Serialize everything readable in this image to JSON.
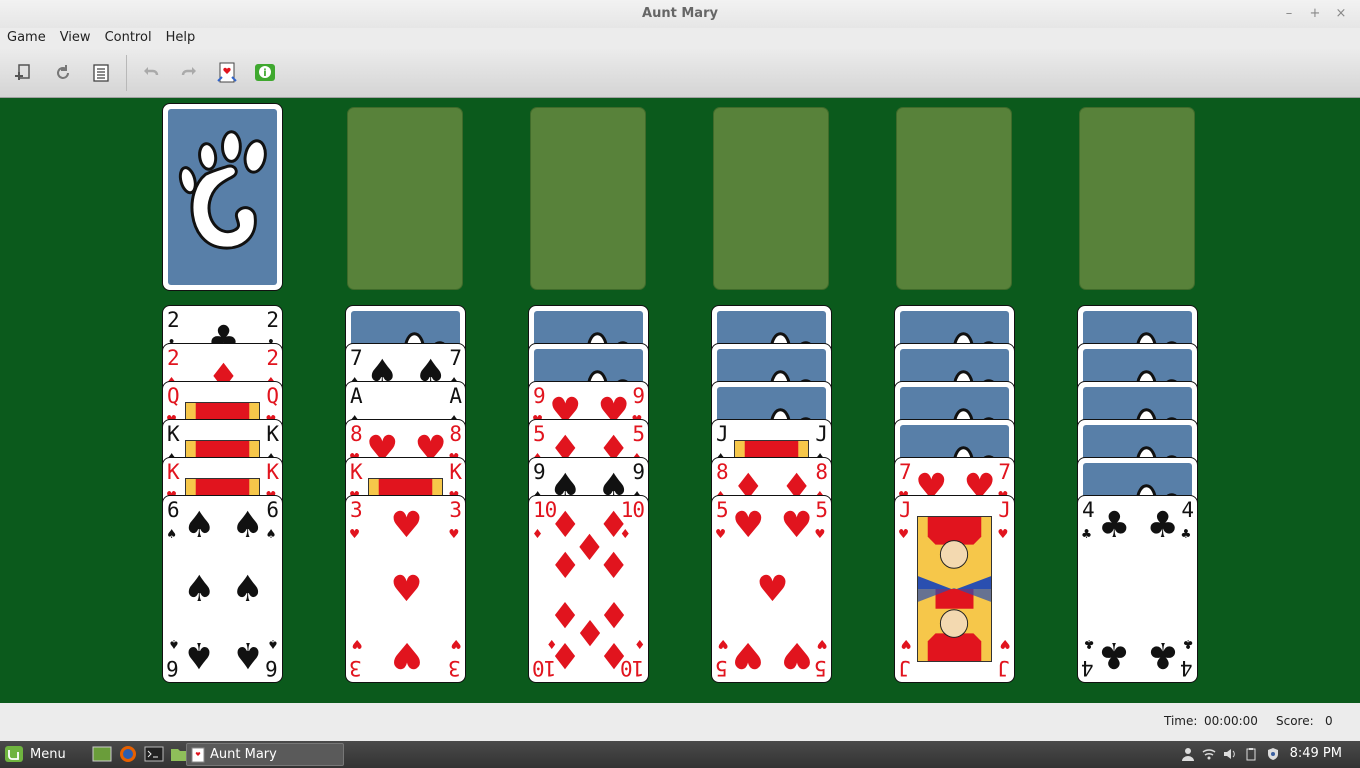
{
  "window": {
    "title": "Aunt Mary",
    "controls": [
      "–",
      "+",
      "×"
    ]
  },
  "menu": [
    "Game",
    "View",
    "Control",
    "Help"
  ],
  "toolbar": [
    "new-game-icon",
    "restart-icon",
    "statistics-icon",
    "undo-icon",
    "redo-icon",
    "hint-icon",
    "info-icon"
  ],
  "stock": {
    "face_down": true
  },
  "foundations": 5,
  "tableau": [
    {
      "down": 0,
      "up": [
        {
          "r": "2",
          "s": "♣"
        },
        {
          "r": "2",
          "s": "♦"
        },
        {
          "r": "Q",
          "s": "♥"
        },
        {
          "r": "K",
          "s": "♠"
        },
        {
          "r": "K",
          "s": "♥"
        },
        {
          "r": "6",
          "s": "♠"
        }
      ]
    },
    {
      "down": 1,
      "up": [
        {
          "r": "7",
          "s": "♠"
        },
        {
          "r": "A",
          "s": "♠"
        },
        {
          "r": "8",
          "s": "♥"
        },
        {
          "r": "K",
          "s": "♥"
        },
        {
          "r": "3",
          "s": "♥"
        }
      ]
    },
    {
      "down": 2,
      "up": [
        {
          "r": "9",
          "s": "♥"
        },
        {
          "r": "5",
          "s": "♦"
        },
        {
          "r": "9",
          "s": "♠"
        },
        {
          "r": "10",
          "s": "♦"
        }
      ]
    },
    {
      "down": 3,
      "up": [
        {
          "r": "J",
          "s": "♠"
        },
        {
          "r": "8",
          "s": "♦"
        },
        {
          "r": "5",
          "s": "♥"
        }
      ]
    },
    {
      "down": 4,
      "up": [
        {
          "r": "7",
          "s": "♥"
        },
        {
          "r": "J",
          "s": "♥"
        }
      ]
    },
    {
      "down": 5,
      "up": [
        {
          "r": "4",
          "s": "♣"
        }
      ]
    }
  ],
  "status": {
    "time_label": "Time:",
    "time_value": "00:00:00",
    "score_label": "Score:",
    "score_value": "0"
  },
  "taskbar": {
    "menu_label": "Menu",
    "task_label": "Aunt Mary",
    "clock": "8:49 PM"
  },
  "colors": {
    "felt": "#0b5a1c",
    "slot": "#58823a",
    "back": "#587fa8",
    "red": "#e1141e"
  }
}
